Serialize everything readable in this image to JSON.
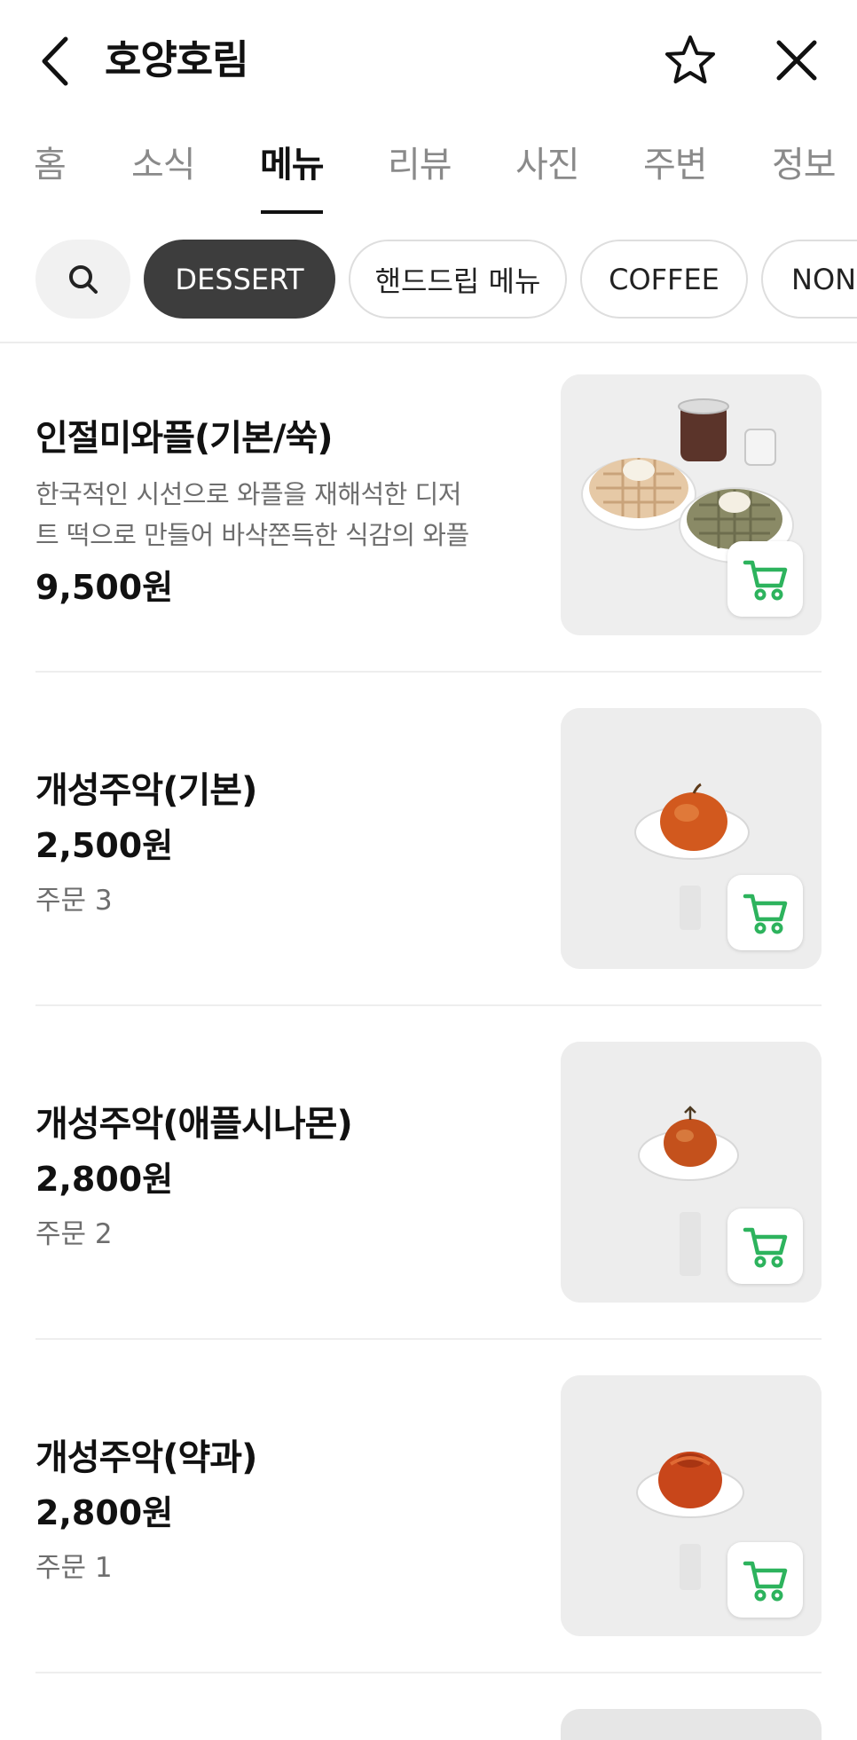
{
  "header": {
    "title": "호양호림",
    "back_icon": "chevron-left-icon",
    "favorite_icon": "star-outline-icon",
    "close_icon": "close-icon"
  },
  "tabs": [
    {
      "label": "홈"
    },
    {
      "label": "소식"
    },
    {
      "label": "메뉴",
      "active": true
    },
    {
      "label": "리뷰"
    },
    {
      "label": "사진"
    },
    {
      "label": "주변"
    },
    {
      "label": "정보"
    }
  ],
  "categories": {
    "search_icon": "search-icon",
    "items": [
      {
        "label": "DESSERT",
        "active": true
      },
      {
        "label": "핸드드립 메뉴"
      },
      {
        "label": "COFFEE"
      },
      {
        "label": "NON"
      }
    ]
  },
  "menu": [
    {
      "name": "인절미와플(기본/쑥)",
      "description_line1": "한국적인 시선으로 와플을 재해석한 디저",
      "description_line2": "트 떡으로 만들어 바삭쫀득한 식감의 와플",
      "price": "9,500원",
      "orders": "",
      "image": "waffle-photo"
    },
    {
      "name": "개성주악(기본)",
      "price": "2,500원",
      "orders": "주문 3",
      "image": "jueak-basic-photo",
      "tag_text": "기본"
    },
    {
      "name": "개성주악(애플시나몬)",
      "price": "2,800원",
      "orders": "주문 2",
      "image": "jueak-apple-cinnamon-photo",
      "tag_text": "애플시나몬"
    },
    {
      "name": "개성주악(약과)",
      "price": "2,800원",
      "orders": "주문 1",
      "image": "jueak-yakgwa-photo",
      "tag_text": "약과"
    }
  ],
  "colors": {
    "cart_icon": "#2db35d",
    "active_chip": "#3d3d3d",
    "inactive_tab": "#8a8a8a"
  }
}
